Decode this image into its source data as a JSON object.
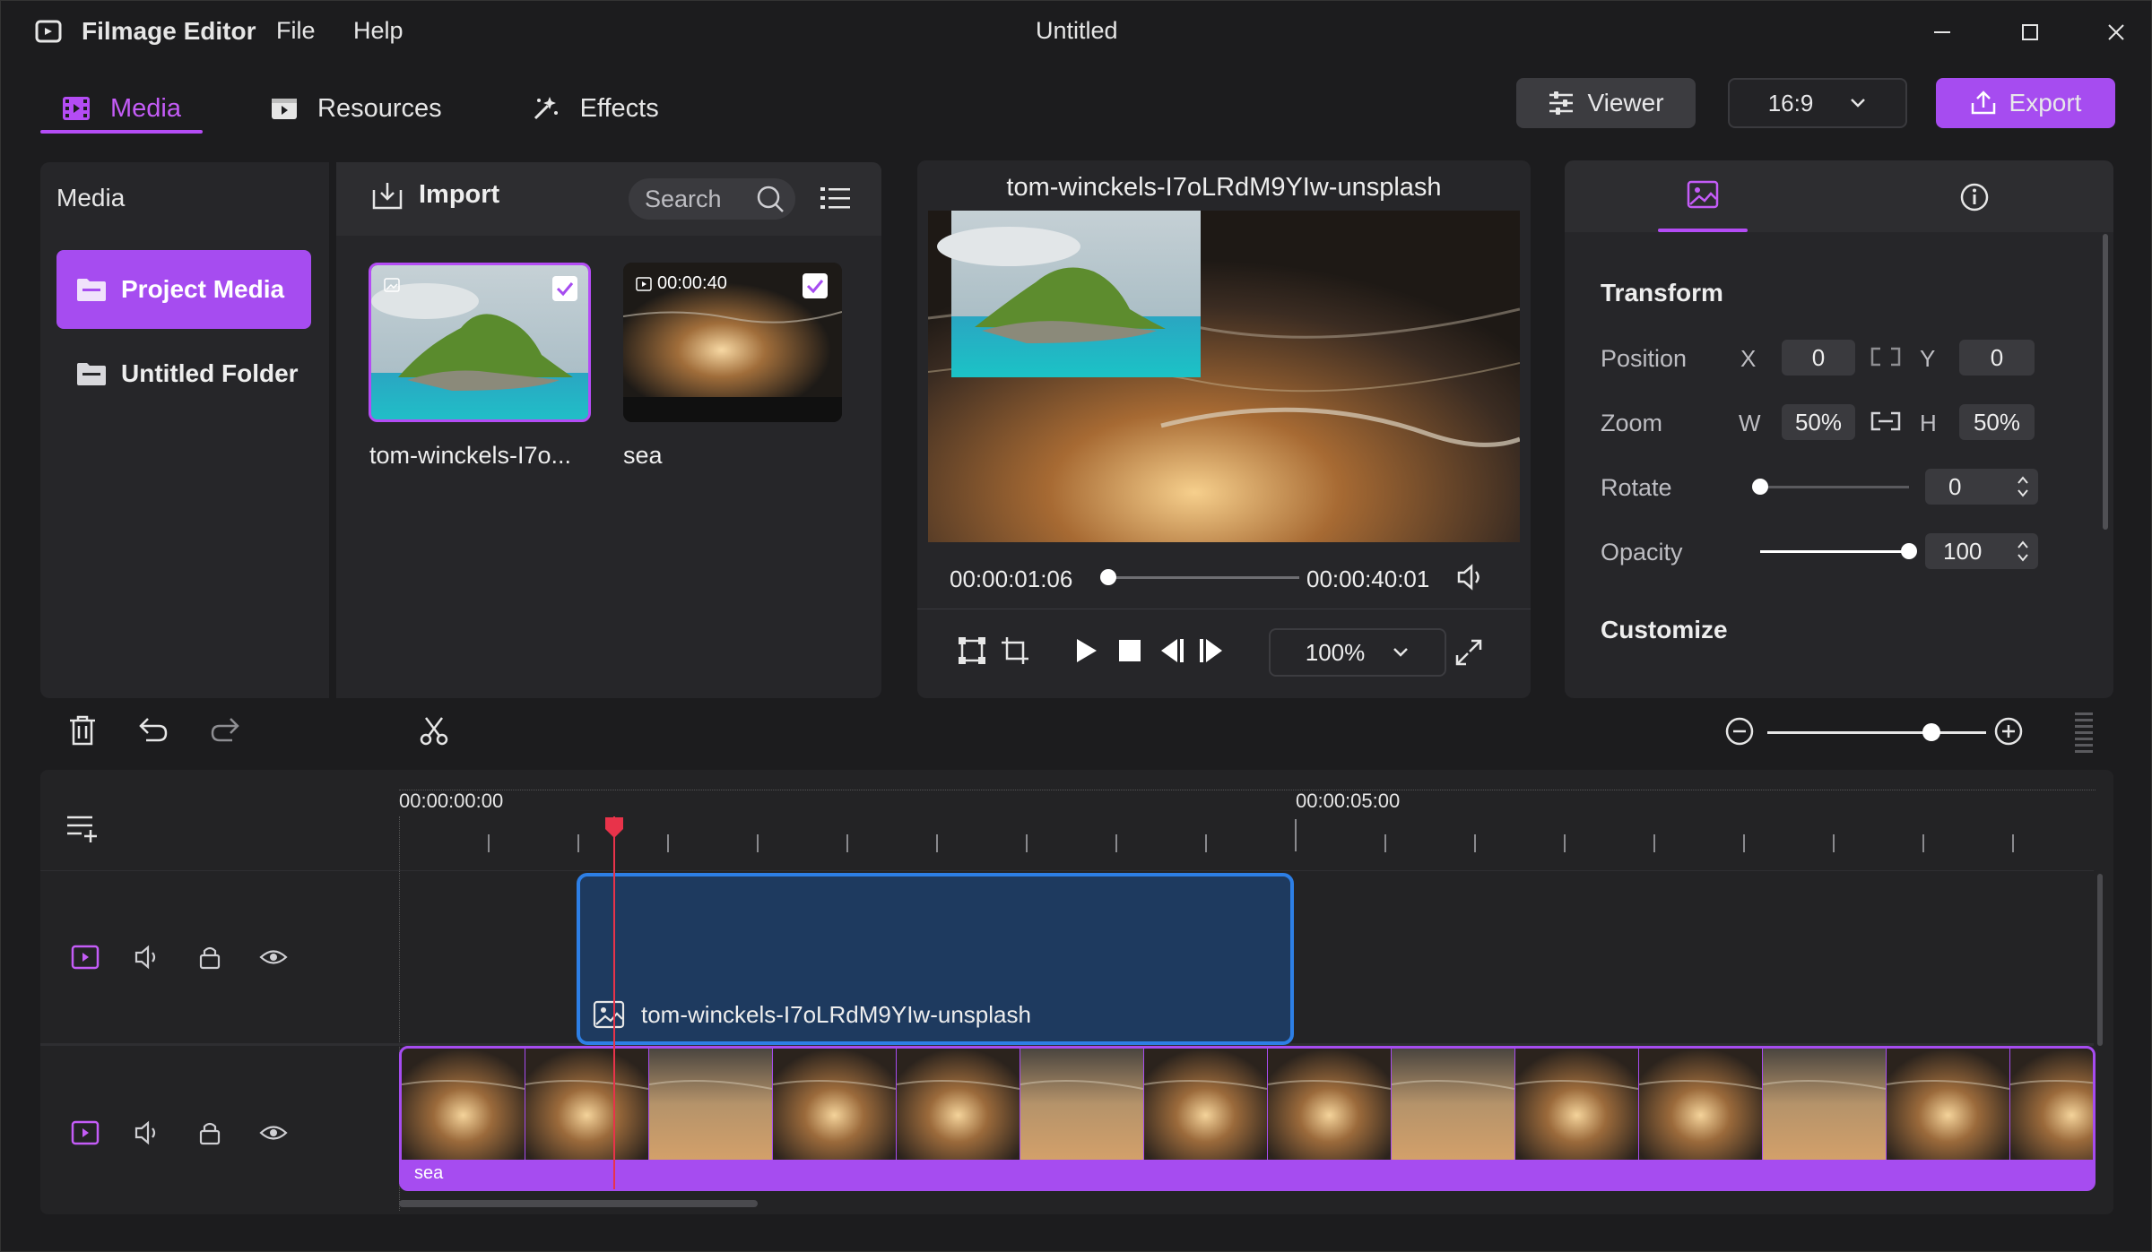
{
  "titlebar": {
    "app_name": "Filmage Editor",
    "menu": [
      "File",
      "Help"
    ],
    "doc_title": "Untitled"
  },
  "tabs": [
    {
      "label": "Media",
      "icon": "film-icon",
      "active": true
    },
    {
      "label": "Resources",
      "icon": "play-square-icon",
      "active": false
    },
    {
      "label": "Effects",
      "icon": "sparkle-icon",
      "active": false
    }
  ],
  "toolbar": {
    "viewer_label": "Viewer",
    "aspect": "16:9",
    "export_label": "Export"
  },
  "media_panel": {
    "title": "Media",
    "folders": [
      {
        "label": "Project Media",
        "selected": true
      },
      {
        "label": "Untitled Folder",
        "selected": false
      }
    ]
  },
  "library": {
    "import_label": "Import",
    "search_placeholder": "Search",
    "items": [
      {
        "name": "tom-winckels-I7o...",
        "type": "image",
        "duration": "",
        "checked": true
      },
      {
        "name": "sea",
        "type": "video",
        "duration": "00:00:40",
        "checked": true
      }
    ]
  },
  "preview": {
    "title": "tom-winckels-I7oLRdM9YIw-unsplash",
    "current_time": "00:00:01:06",
    "total_time": "00:00:40:01",
    "progress": 0.03,
    "zoom": "100%"
  },
  "properties": {
    "section_transform": "Transform",
    "position_label": "Position",
    "x_label": "X",
    "x_value": "0",
    "y_label": "Y",
    "y_value": "0",
    "zoom_label": "Zoom",
    "w_label": "W",
    "w_value": "50%",
    "h_label": "H",
    "h_value": "50%",
    "rotate_label": "Rotate",
    "rotate_value": "0",
    "rotate_level": 0,
    "opacity_label": "Opacity",
    "opacity_value": "100",
    "opacity_level": 1.0,
    "section_customize": "Customize"
  },
  "timeline": {
    "ruler_start": "00:00:00:00",
    "ruler_mid": "00:00:05:00",
    "clip_image_label": "tom-winckels-I7oLRdM9YIw-unsplash",
    "clip_video_label": "sea",
    "zoom_level": 0.75
  },
  "colors": {
    "accent": "#a64cf0",
    "clip_blue": "#2d7fe6",
    "playhead": "#e8334a"
  }
}
